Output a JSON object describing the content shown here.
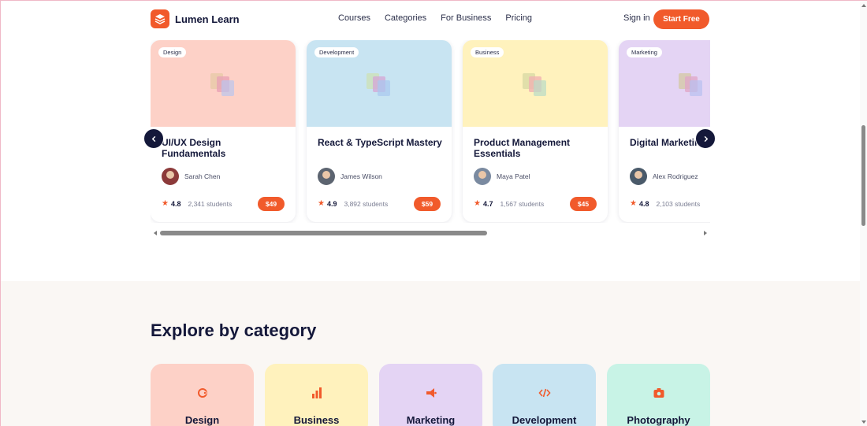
{
  "brand": {
    "name": "Lumen Learn",
    "accent": "#f15a2b",
    "dark": "#14183a"
  },
  "nav": {
    "items": [
      "Courses",
      "Categories",
      "For Business",
      "Pricing"
    ],
    "signin": "Sign in",
    "cta": "Start Free"
  },
  "courses": [
    {
      "tag": "Design",
      "title": "UI/UX Design Fundamentals",
      "author": "Sarah Chen",
      "rating": "4.8",
      "students": "2,341 students",
      "price": "$49",
      "color": "#fdd1c7"
    },
    {
      "tag": "Development",
      "title": "React & TypeScript Mastery",
      "author": "James Wilson",
      "rating": "4.9",
      "students": "3,892 students",
      "price": "$59",
      "color": "#c8e4f2"
    },
    {
      "tag": "Business",
      "title": "Product Management Essentials",
      "author": "Maya Patel",
      "rating": "4.7",
      "students": "1,567 students",
      "price": "$45",
      "color": "#fff2bd"
    },
    {
      "tag": "Marketing",
      "title": "Digital Marketing Strategy",
      "author": "Alex Rodriguez",
      "rating": "4.8",
      "students": "2,103 students",
      "price": "",
      "color": "#e4d4f4"
    }
  ],
  "categories": {
    "heading": "Explore by category",
    "items": [
      {
        "label": "Design",
        "icon": "palette-icon",
        "color": "#fdd1c7"
      },
      {
        "label": "Business",
        "icon": "bar-chart-icon",
        "color": "#fff2bd"
      },
      {
        "label": "Marketing",
        "icon": "megaphone-icon",
        "color": "#e4d4f4"
      },
      {
        "label": "Development",
        "icon": "code-icon",
        "color": "#c8e4f2"
      },
      {
        "label": "Photography",
        "icon": "camera-icon",
        "color": "#c8f3e6"
      }
    ]
  }
}
